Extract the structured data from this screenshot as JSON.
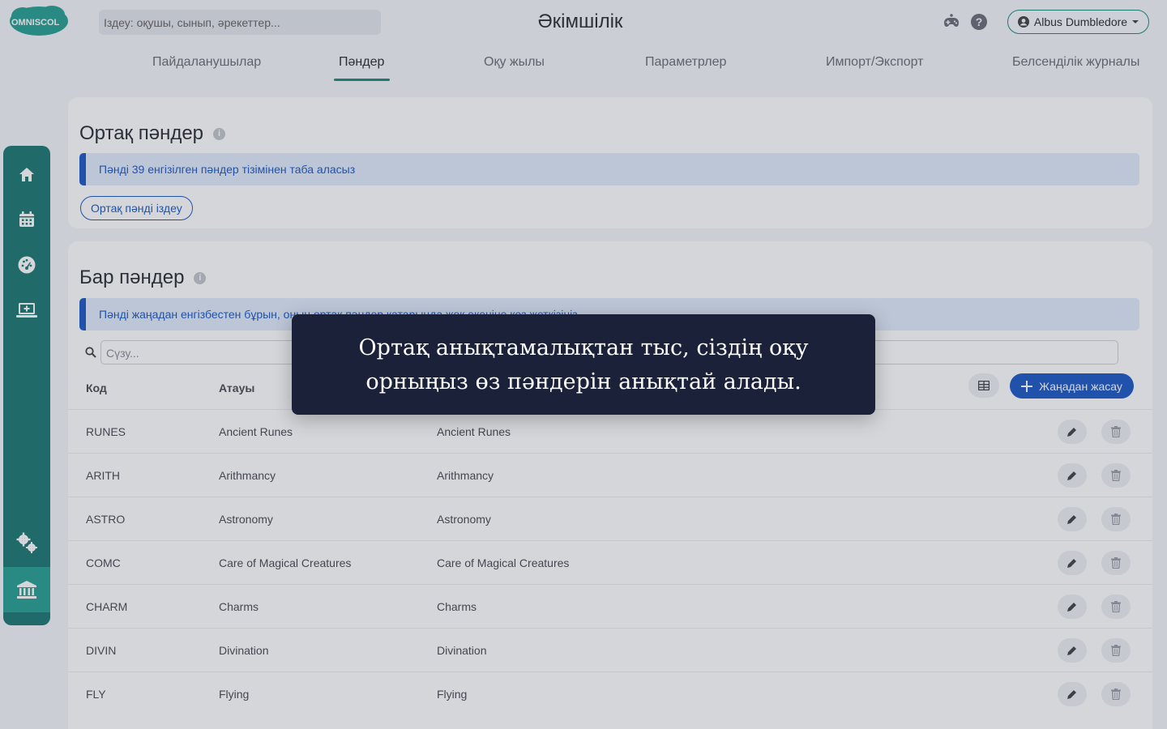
{
  "header": {
    "logo_text": "OMNISCOL",
    "search_placeholder": "Іздеу: оқушы, сынып, әрекеттер...",
    "title": "Әкімшілік",
    "user_name": "Albus Dumbledore",
    "icons": [
      "gamepad-icon",
      "help-icon"
    ]
  },
  "tabs": [
    {
      "label": "Пайдаланушылар"
    },
    {
      "label": "Пәндер"
    },
    {
      "label": "Оқу жылы"
    },
    {
      "label": "Параметрлер"
    },
    {
      "label": "Импорт/Экспорт"
    },
    {
      "label": "Белсенділік журналы"
    }
  ],
  "active_tab": "Пәндер",
  "sidebar": {
    "icons": [
      "home-icon",
      "calendar-icon",
      "dashboard-gauge-icon",
      "laptop-add-icon",
      "settings-gears-icon",
      "institution-icon"
    ],
    "active": "institution-icon"
  },
  "common_subjects": {
    "title": "Ортақ пәндер",
    "info_text": "Пәнді 39 енгізілген пәндер тізімінен таба аласыз",
    "search_button": "Ортақ пәнді іздеу"
  },
  "existing_subjects": {
    "title": "Бар пәндер",
    "info_text": "Пәнді жаңадан енгізбестен бұрын, оның ортақ пәндер қатарында жоқ екеніне көз жеткізіңіз",
    "filter_placeholder": "Сүзу...",
    "columns": [
      "Код",
      "Атауы",
      ""
    ],
    "create_button": "Жаңадан жасау",
    "rows": [
      {
        "code": "RUNES",
        "name": "Ancient Runes",
        "name2": "Ancient Runes"
      },
      {
        "code": "ARITH",
        "name": "Arithmancy",
        "name2": "Arithmancy"
      },
      {
        "code": "ASTRO",
        "name": "Astronomy",
        "name2": "Astronomy"
      },
      {
        "code": "COMC",
        "name": "Care of Magical Creatures",
        "name2": "Care of Magical Creatures"
      },
      {
        "code": "CHARM",
        "name": "Charms",
        "name2": "Charms"
      },
      {
        "code": "DIVIN",
        "name": "Divination",
        "name2": "Divination"
      },
      {
        "code": "FLY",
        "name": "Flying",
        "name2": "Flying"
      }
    ]
  },
  "tooltip": {
    "text": "Ортақ анықтамалықтан тыс, сіздің оқу орныңыз өз пәндерін анықтай алады."
  },
  "colors": {
    "teal": "#1f7a72",
    "teal_active": "#2aa094",
    "blue": "#1e5bc6",
    "tooltip_bg": "#1b2139"
  }
}
